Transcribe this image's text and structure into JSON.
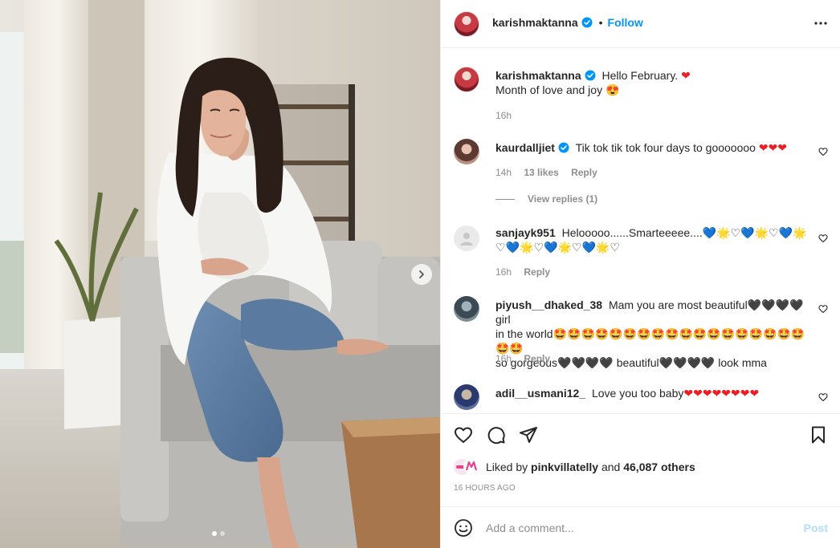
{
  "post": {
    "owner": "karishmaktanna",
    "follow_label": "Follow",
    "follow_separator": "•",
    "caption_line1": "Hello February.",
    "caption_line2": "Month of love and joy",
    "caption_time": "16h"
  },
  "comments": [
    {
      "user": "kaurdalljiet",
      "verified": true,
      "text": "Tik tok tik tok four days to gooooooo",
      "time": "14h",
      "likes": "13 likes",
      "reply": "Reply",
      "view_replies": "View replies (1)"
    },
    {
      "user": "sanjayk951",
      "text_line1": "Helooooo......Smarteeeee....",
      "time": "16h",
      "reply": "Reply"
    },
    {
      "user": "piyush__dhaked_38",
      "text_part1": "Mam you are most beautiful",
      "text_part2": "girl",
      "text_line2": "in the world",
      "text_line3a": "so gorgeous",
      "text_line3b": "beautiful",
      "text_line3c": "look mma",
      "time": "16h",
      "reply": "Reply"
    },
    {
      "user": "adil__usmani12_",
      "text": "Love you too baby"
    }
  ],
  "likes": {
    "prefix": "Liked by",
    "liker": "pinkvillatelly",
    "joiner": "and",
    "others": "46,087 others"
  },
  "time_ago": "16 HOURS AGO",
  "comment_input": {
    "placeholder": "Add a comment..."
  },
  "post_label": "Post",
  "colors": {
    "link_blue": "#0095f6",
    "post_disabled": "#b2dffc",
    "heart_red": "#ed1d24",
    "muted": "#8e8e8e"
  },
  "icons": [
    "verified-badge-icon",
    "more-options-icon",
    "heart-icon",
    "comment-icon",
    "share-icon",
    "bookmark-icon",
    "emoji-icon",
    "chevron-right-icon"
  ]
}
